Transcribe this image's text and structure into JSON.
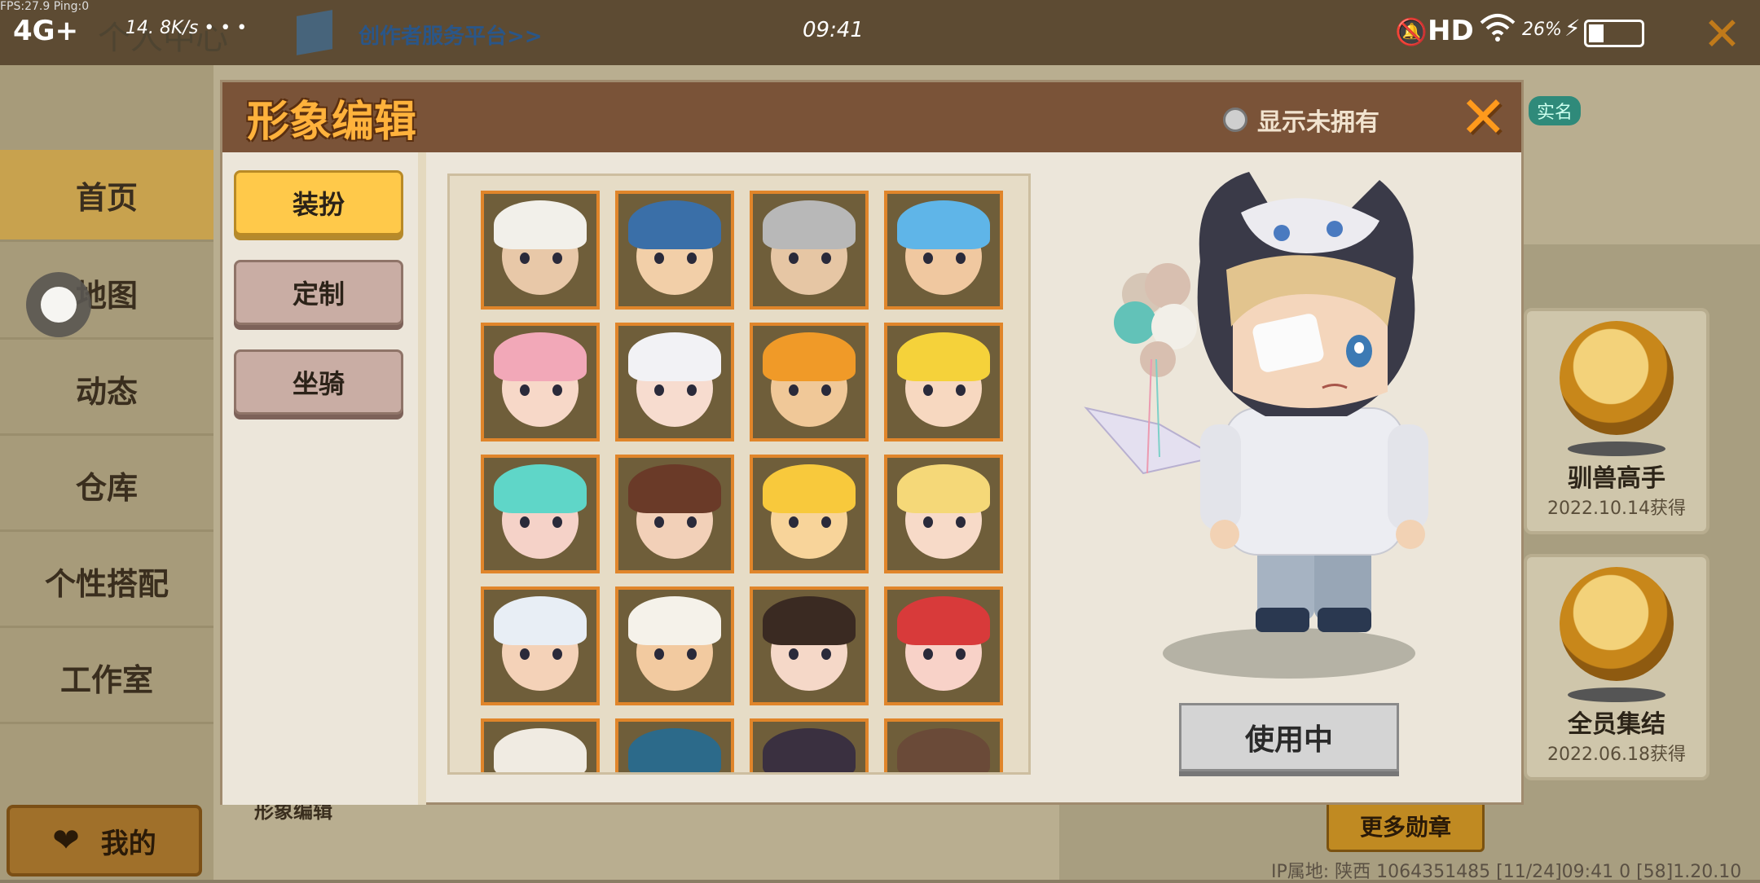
{
  "status_bar": {
    "fps": "FPS:27.9  Ping:0",
    "network": "4G+",
    "speed": "14. 8K/s  • • •",
    "time": "09:41",
    "hd": "HD",
    "battery": "26%"
  },
  "background": {
    "user_center": "个人中心",
    "creator_link": "创作者服务平台>>",
    "nav": [
      "首页",
      "地图",
      "动态",
      "仓库",
      "个性搭配",
      "工作室"
    ],
    "mine_label": "我的",
    "real_name": "实名",
    "medals": [
      {
        "name": "驯兽高手",
        "date": "2022.10.14获得"
      },
      {
        "name": "全员集结",
        "date": "2022.06.18获得"
      }
    ],
    "more_medals": "更多勋章",
    "section_label": "形象编辑",
    "ip_info": "IP属地: 陕西  1064351485   [11/24]09:41 0  [58]1.20.10"
  },
  "dialog": {
    "title": "形象编辑",
    "show_unowned": "显示未拥有",
    "tabs": [
      {
        "label": "装扮",
        "active": true
      },
      {
        "label": "定制",
        "active": false
      },
      {
        "label": "坐骑",
        "active": false
      }
    ],
    "use_button": "使用中"
  },
  "skins": [
    {
      "hat": "#f2f0ea",
      "face": "#e8c8a8"
    },
    {
      "hat": "#3a6fa8",
      "face": "#f2cfa8"
    },
    {
      "hat": "#b8b8b8",
      "face": "#e6c6a4"
    },
    {
      "hat": "#5fb5e8",
      "face": "#f0c8a0"
    },
    {
      "hat": "#f2a8b8",
      "face": "#f7d8c8"
    },
    {
      "hat": "#f2f2f5",
      "face": "#f7dccf"
    },
    {
      "hat": "#f09a28",
      "face": "#f0c898"
    },
    {
      "hat": "#f5d23a",
      "face": "#f7d8c0"
    },
    {
      "hat": "#5fd6c8",
      "face": "#f5d2c8"
    },
    {
      "hat": "#6a3a28",
      "face": "#f2d0b8"
    },
    {
      "hat": "#f8c93c",
      "face": "#f8d49a"
    },
    {
      "hat": "#f5d878",
      "face": "#f7dac8"
    },
    {
      "hat": "#e8eef5",
      "face": "#f4d2b8"
    },
    {
      "hat": "#f5f2ea",
      "face": "#f2caa0"
    },
    {
      "hat": "#3a2a22",
      "face": "#f5d8c8"
    },
    {
      "hat": "#d83a3a",
      "face": "#f8d2c8"
    },
    {
      "hat": "#f0ebe2",
      "face": "#f2d2b0"
    },
    {
      "hat": "#2c6a8a",
      "face": "#f2ccb0"
    },
    {
      "hat": "#3a3040",
      "face": "#e8dcd0"
    },
    {
      "hat": "#6a4a38",
      "face": "#e8c8b0"
    }
  ]
}
